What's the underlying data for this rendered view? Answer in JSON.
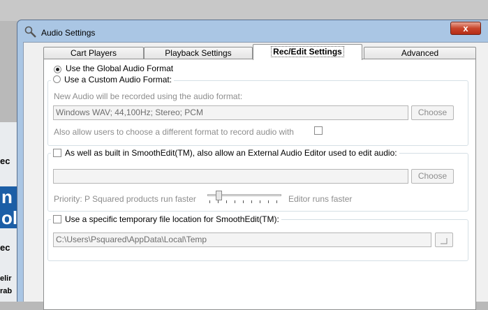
{
  "background": {
    "fragments": [
      "ec",
      "n",
      "ol",
      "ec",
      "elir",
      "rab"
    ]
  },
  "window": {
    "title": "Audio Settings",
    "close_label": "x"
  },
  "tabs": [
    {
      "label": "Cart Players",
      "active": false
    },
    {
      "label": "Playback Settings",
      "active": false
    },
    {
      "label": "Rec/Edit Settings",
      "active": true
    },
    {
      "label": "Advanced",
      "active": false
    }
  ],
  "format": {
    "global_label": "Use the Global Audio Format",
    "custom_label": "Use a Custom Audio Format:",
    "description": "New Audio will be recorded using the audio format:",
    "value": "Windows WAV; 44,100Hz; Stereo; PCM",
    "choose_label": "Choose",
    "allow_label": "Also allow users to choose a different format to record audio with"
  },
  "external_editor": {
    "label": "As well as built in SmoothEdit(TM), also allow an External Audio Editor used to edit audio:",
    "value": "",
    "choose_label": "Choose",
    "priority_label": "Priority:  P Squared products run faster",
    "editor_label": "Editor runs faster"
  },
  "temp_location": {
    "label": "Use a specific temporary file location for SmoothEdit(TM):",
    "value": "C:\\Users\\Psquared\\AppData\\Local\\Temp",
    "browse_label": "..."
  }
}
